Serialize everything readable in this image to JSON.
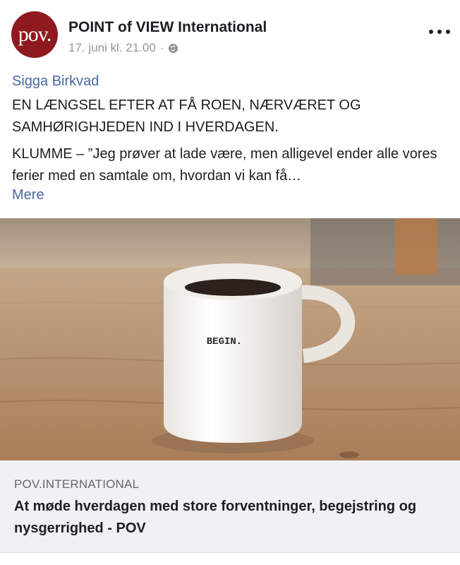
{
  "post": {
    "page_name": "POINT of VIEW International",
    "avatar_text": "pov.",
    "timestamp": "17. juni kl. 21.00",
    "separator": "·",
    "audience_icon": "globe-icon",
    "menu_icon": "more-options-icon",
    "author": "Sigga Birkvad",
    "headline": "EN LÆNGSEL EFTER AT FÅ ROEN, NÆRVÆRET OG SAMHØRIGHJEDEN IND I HVERDAGEN.",
    "excerpt": "KLUMME – ”Jeg prøver at lade være, men alligevel ender alle vores ferier med en samtale om, hvordan vi kan få…",
    "more_label": "Mere"
  },
  "photo": {
    "mug_text": "BEGIN."
  },
  "link_card": {
    "domain": "POV.INTERNATIONAL",
    "title": "At møde hverdagen med store forventninger, begejstring og nysgerrighed - POV"
  },
  "colors": {
    "brand": "#8e1a1f",
    "link": "#4b67a1",
    "muted": "#90949c"
  }
}
